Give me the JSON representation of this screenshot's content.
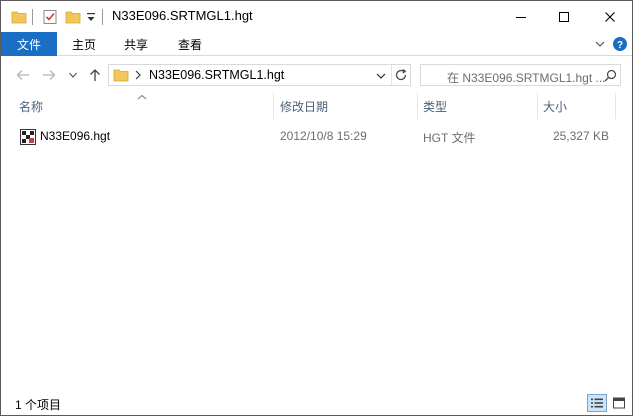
{
  "window": {
    "title": "N33E096.SRTMGL1.hgt"
  },
  "ribbon": {
    "tabs": [
      {
        "label": "文件"
      },
      {
        "label": "主页"
      },
      {
        "label": "共享"
      },
      {
        "label": "查看"
      }
    ]
  },
  "address": {
    "path_segment": "N33E096.SRTMGL1.hgt"
  },
  "search": {
    "placeholder": "在 N33E096.SRTMGL1.hgt ..."
  },
  "columns": {
    "name": "名称",
    "modified": "修改日期",
    "type": "类型",
    "size": "大小"
  },
  "files": [
    {
      "name": "N33E096.hgt",
      "modified": "2012/10/8 15:29",
      "type": "HGT 文件",
      "size": "25,327 KB"
    }
  ],
  "status": {
    "item_count": "1 个项目"
  },
  "colors": {
    "accent": "#1a6fc4",
    "folder": "#f1c75c",
    "header_text": "#4c607a"
  }
}
